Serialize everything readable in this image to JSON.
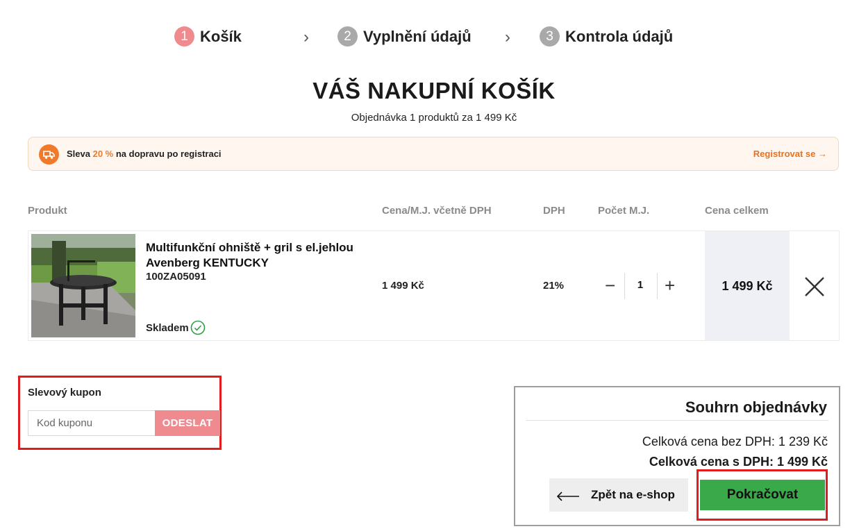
{
  "steps": [
    {
      "num": "1",
      "label": "Košík"
    },
    {
      "num": "2",
      "label": "Vyplnění údajů"
    },
    {
      "num": "3",
      "label": "Kontrola údajů"
    }
  ],
  "page": {
    "title": "VÁŠ NAKUPNÍ KOŠÍK",
    "subtitle": "Objednávka 1 produktů za 1 499 Kč"
  },
  "promo": {
    "prefix": "Sleva ",
    "highlight": "20 %",
    "suffix": " na dopravu po registraci",
    "link": "Registrovat se →",
    "accent": "#f07a2c"
  },
  "table": {
    "headers": {
      "product": "Produkt",
      "unit_price": "Cena/M.J. včetně DPH",
      "vat": "DPH",
      "qty": "Počet M.J.",
      "total": "Cena celkem"
    }
  },
  "item": {
    "name_line1": "Multifunkční ohniště + gril s el.jehlou",
    "name_line2": "Avenberg KENTUCKY",
    "code": "100ZA05091",
    "stock": "Skladem",
    "unit_price": "1 499 Kč",
    "vat": "21%",
    "qty": "1",
    "minus": "−",
    "plus": "+",
    "total": "1 499 Kč"
  },
  "coupon": {
    "label": "Slevový kupon",
    "placeholder": "Kod kuponu",
    "button": "ODESLAT"
  },
  "summary": {
    "title": "Souhrn objednávky",
    "without_vat": "Celková cena bez DPH: 1 239 Kč",
    "with_vat": "Celková cena s DPH: 1 499 Kč",
    "back": "Zpět na e-shop",
    "continue": "Pokračovat"
  },
  "colors": {
    "step_active": "#ef8a8f",
    "step_inactive": "#a9a9a9",
    "continue_bg": "#3aa94a",
    "highlight_frame": "#e01c1c"
  }
}
